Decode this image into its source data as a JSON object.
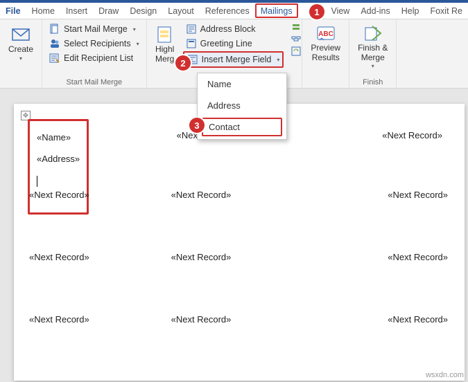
{
  "tabs": {
    "file": "File",
    "home": "Home",
    "insert": "Insert",
    "draw": "Draw",
    "design": "Design",
    "layout": "Layout",
    "references": "References",
    "mailings": "Mailings",
    "partial_w": "w",
    "view": "View",
    "addins": "Add-ins",
    "help": "Help",
    "foxit": "Foxit Re"
  },
  "callouts": {
    "c1": "1",
    "c2": "2",
    "c3": "3"
  },
  "ribbon": {
    "create": {
      "label": "Create"
    },
    "startGroup": {
      "startMailMerge": "Start Mail Merge",
      "selectRecipients": "Select Recipients",
      "editRecipientList": "Edit Recipient List",
      "groupLabel": "Start Mail Merge"
    },
    "writeGroup": {
      "highlightMerge1": "Highl",
      "highlightMerge2": "Merg",
      "addressBlock": "Address Block",
      "greetingLine": "Greeting Line",
      "insertMergeField": "Insert Merge Field"
    },
    "previewGroup": {
      "preview1": "Preview",
      "preview2": "Results"
    },
    "finishGroup": {
      "finish1": "Finish &",
      "finish2": "Merge",
      "groupLabel": "Finish"
    }
  },
  "dropdown": {
    "name": "Name",
    "address": "Address",
    "contact": "Contact"
  },
  "doc": {
    "field_name": "«Name»",
    "field_address": "«Address»",
    "next_record": "«Next Record»"
  },
  "watermark": "wsxdn.com"
}
